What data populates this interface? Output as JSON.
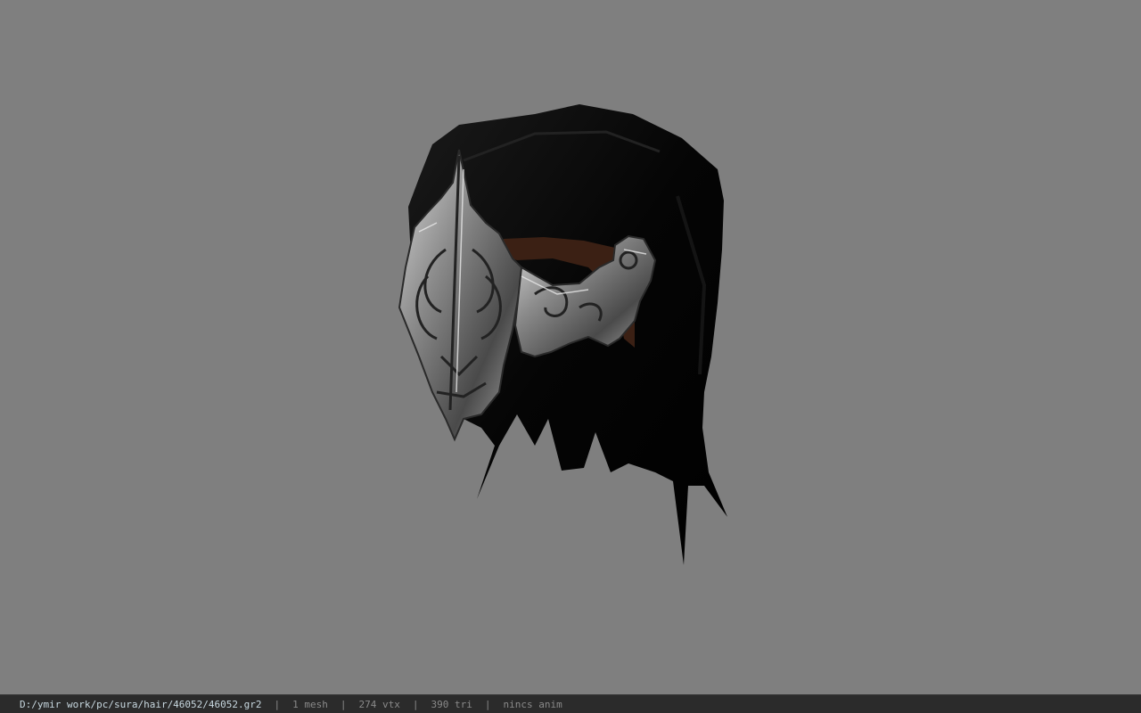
{
  "viewport": {
    "background": "#7f7f7f",
    "model_name": "hair-with-ornate-headpiece"
  },
  "status": {
    "file_path": "D:/ymir work/pc/sura/hair/46052/46052.gr2",
    "mesh_count": "1 mesh",
    "vertex_count": "274 vtx",
    "triangle_count": "390 tri",
    "anim_status": "nincs anim",
    "separator": "|"
  }
}
